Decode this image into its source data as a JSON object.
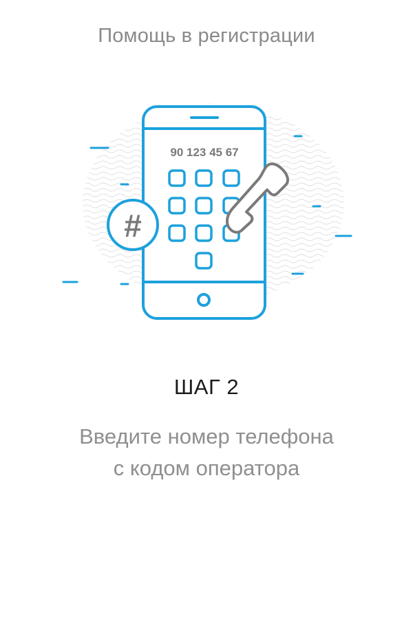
{
  "header": {
    "title": "Помощь в регистрации"
  },
  "illustration": {
    "phone_number": "90 123 45 67",
    "hash_symbol": "#",
    "accent_color": "#1da1dc",
    "secondary_color": "#7a7a7a"
  },
  "step": {
    "title": "ШАГ 2",
    "description_line1": "Введите номер телефона",
    "description_line2": "с кодом оператора"
  }
}
